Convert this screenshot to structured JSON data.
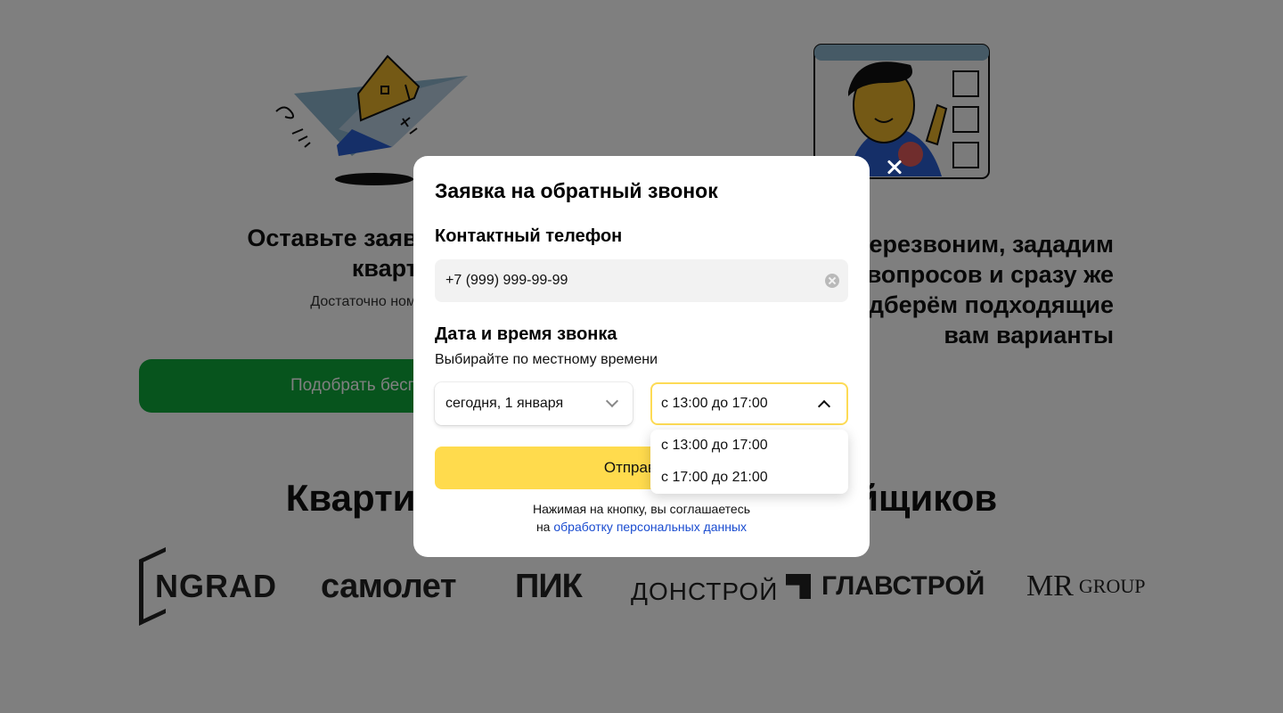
{
  "background": {
    "left_title": "Оставьте заявку на подбор квартиры",
    "left_subtitle": "Достаточно номера телефона",
    "right_title": "Мы перезвоним, зададим несколько вопросов и сразу же бесплатно подберём подходящие вам варианты",
    "promo_button": "Подобрать бесплатно",
    "developers_title": "Квартиры от надёжных застройщиков",
    "logos": {
      "ingrad": "NGRAD",
      "samolet": "самолет",
      "pik": "ПИК",
      "donstroy": "ДОНСТРОЙ",
      "glavstroy": "ГЛАВСТРОЙ",
      "mr": "MR",
      "mr_group": "GROUP"
    }
  },
  "modal": {
    "title": "Заявка на обратный звонок",
    "phone_label": "Контактный телефон",
    "phone_value": "+7 (999) 999-99-99",
    "datetime_label": "Дата и время звонка",
    "datetime_hint": "Выбирайте по местному времени",
    "date_select_value": "сегодня, 1 января",
    "time_select_value": "с 13:00 до 17:00",
    "time_options": [
      "с 13:00 до 17:00",
      "с 17:00 до 21:00"
    ],
    "submit_label": "Отправить",
    "consent_text": "Нажимая на кнопку, вы соглашаетесь",
    "consent_prefix": "на",
    "consent_link": "обработку персональных данных"
  },
  "colors": {
    "accent_yellow": "#ffdb4d",
    "promo_green": "#0ea83b",
    "link_blue": "#1a4cd0"
  }
}
